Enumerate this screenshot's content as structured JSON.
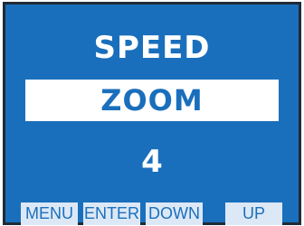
{
  "screen": {
    "title": "SPEED",
    "selected_option": "ZOOM",
    "value": "4"
  },
  "softkeys": {
    "menu": "MENU",
    "enter": "ENTER",
    "down": "DOWN",
    "up": "UP"
  },
  "colors": {
    "background": "#1a6fbc",
    "border": "#1f2a36",
    "highlight": "#ffffff",
    "softkey_bg": "#dce8f6",
    "text": "#ffffff"
  }
}
